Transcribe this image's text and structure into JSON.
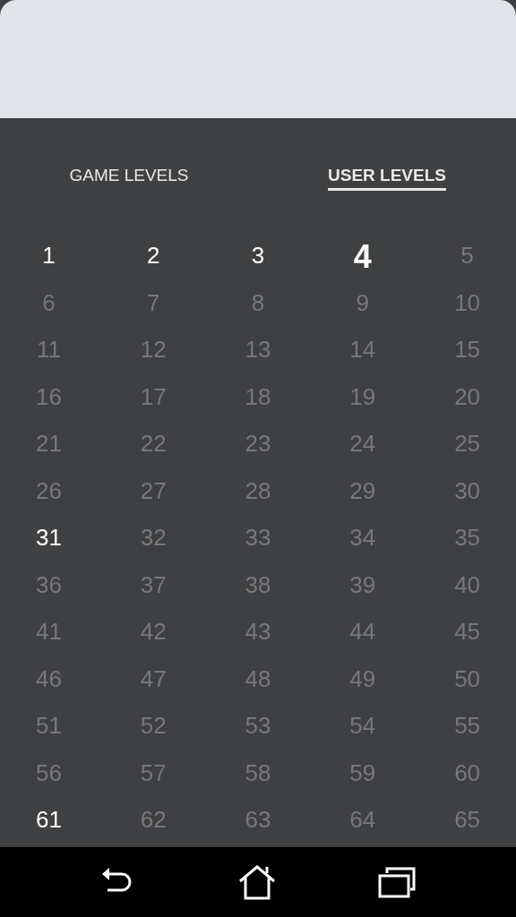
{
  "tabs": [
    {
      "label": "GAME LEVELS",
      "selected": false
    },
    {
      "label": "USER LEVELS",
      "selected": true
    }
  ],
  "levels": [
    {
      "label": "1",
      "unlocked": true,
      "selected": false
    },
    {
      "label": "2",
      "unlocked": true,
      "selected": false
    },
    {
      "label": "3",
      "unlocked": true,
      "selected": false
    },
    {
      "label": "4",
      "unlocked": true,
      "selected": true
    },
    {
      "label": "5",
      "unlocked": false,
      "selected": false
    },
    {
      "label": "6",
      "unlocked": false,
      "selected": false
    },
    {
      "label": "7",
      "unlocked": false,
      "selected": false
    },
    {
      "label": "8",
      "unlocked": false,
      "selected": false
    },
    {
      "label": "9",
      "unlocked": false,
      "selected": false
    },
    {
      "label": "10",
      "unlocked": false,
      "selected": false
    },
    {
      "label": "11",
      "unlocked": false,
      "selected": false
    },
    {
      "label": "12",
      "unlocked": false,
      "selected": false
    },
    {
      "label": "13",
      "unlocked": false,
      "selected": false
    },
    {
      "label": "14",
      "unlocked": false,
      "selected": false
    },
    {
      "label": "15",
      "unlocked": false,
      "selected": false
    },
    {
      "label": "16",
      "unlocked": false,
      "selected": false
    },
    {
      "label": "17",
      "unlocked": false,
      "selected": false
    },
    {
      "label": "18",
      "unlocked": false,
      "selected": false
    },
    {
      "label": "19",
      "unlocked": false,
      "selected": false
    },
    {
      "label": "20",
      "unlocked": false,
      "selected": false
    },
    {
      "label": "21",
      "unlocked": false,
      "selected": false
    },
    {
      "label": "22",
      "unlocked": false,
      "selected": false
    },
    {
      "label": "23",
      "unlocked": false,
      "selected": false
    },
    {
      "label": "24",
      "unlocked": false,
      "selected": false
    },
    {
      "label": "25",
      "unlocked": false,
      "selected": false
    },
    {
      "label": "26",
      "unlocked": false,
      "selected": false
    },
    {
      "label": "27",
      "unlocked": false,
      "selected": false
    },
    {
      "label": "28",
      "unlocked": false,
      "selected": false
    },
    {
      "label": "29",
      "unlocked": false,
      "selected": false
    },
    {
      "label": "30",
      "unlocked": false,
      "selected": false
    },
    {
      "label": "31",
      "unlocked": true,
      "selected": false
    },
    {
      "label": "32",
      "unlocked": false,
      "selected": false
    },
    {
      "label": "33",
      "unlocked": false,
      "selected": false
    },
    {
      "label": "34",
      "unlocked": false,
      "selected": false
    },
    {
      "label": "35",
      "unlocked": false,
      "selected": false
    },
    {
      "label": "36",
      "unlocked": false,
      "selected": false
    },
    {
      "label": "37",
      "unlocked": false,
      "selected": false
    },
    {
      "label": "38",
      "unlocked": false,
      "selected": false
    },
    {
      "label": "39",
      "unlocked": false,
      "selected": false
    },
    {
      "label": "40",
      "unlocked": false,
      "selected": false
    },
    {
      "label": "41",
      "unlocked": false,
      "selected": false
    },
    {
      "label": "42",
      "unlocked": false,
      "selected": false
    },
    {
      "label": "43",
      "unlocked": false,
      "selected": false
    },
    {
      "label": "44",
      "unlocked": false,
      "selected": false
    },
    {
      "label": "45",
      "unlocked": false,
      "selected": false
    },
    {
      "label": "46",
      "unlocked": false,
      "selected": false
    },
    {
      "label": "47",
      "unlocked": false,
      "selected": false
    },
    {
      "label": "48",
      "unlocked": false,
      "selected": false
    },
    {
      "label": "49",
      "unlocked": false,
      "selected": false
    },
    {
      "label": "50",
      "unlocked": false,
      "selected": false
    },
    {
      "label": "51",
      "unlocked": false,
      "selected": false
    },
    {
      "label": "52",
      "unlocked": false,
      "selected": false
    },
    {
      "label": "53",
      "unlocked": false,
      "selected": false
    },
    {
      "label": "54",
      "unlocked": false,
      "selected": false
    },
    {
      "label": "55",
      "unlocked": false,
      "selected": false
    },
    {
      "label": "56",
      "unlocked": false,
      "selected": false
    },
    {
      "label": "57",
      "unlocked": false,
      "selected": false
    },
    {
      "label": "58",
      "unlocked": false,
      "selected": false
    },
    {
      "label": "59",
      "unlocked": false,
      "selected": false
    },
    {
      "label": "60",
      "unlocked": false,
      "selected": false
    },
    {
      "label": "61",
      "unlocked": true,
      "selected": false
    },
    {
      "label": "62",
      "unlocked": false,
      "selected": false
    },
    {
      "label": "63",
      "unlocked": false,
      "selected": false
    },
    {
      "label": "64",
      "unlocked": false,
      "selected": false
    },
    {
      "label": "65",
      "unlocked": false,
      "selected": false
    }
  ]
}
